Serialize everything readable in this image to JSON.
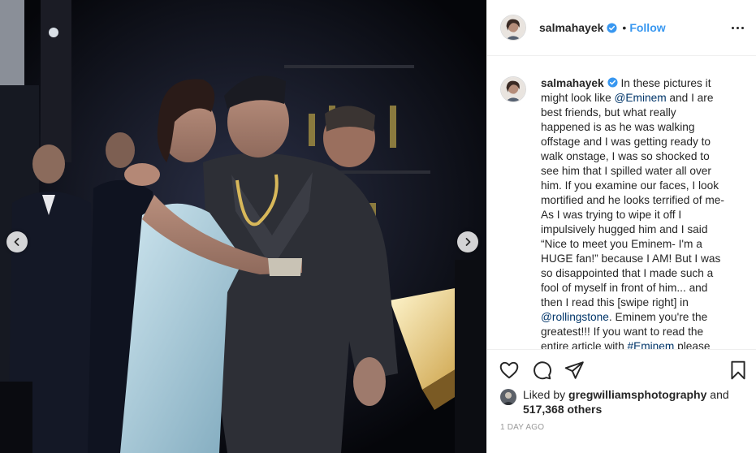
{
  "post": {
    "username": "salmahayek",
    "follow_label": "Follow",
    "dot": "•",
    "caption_lines": [
      "In these pictures it",
      "might look like ",
      " and I are",
      "best friends, but what really",
      "happened is as he was walking",
      "offstage and I was getting ready to",
      "walk onstage, I was so shocked to",
      "see him that I spilled water all over",
      "him. If you examine our faces, I look",
      "mortified and he looks terrified of me-",
      "As I was trying to wipe it off I",
      "impulsively hugged him and I said",
      "“Nice to meet you Eminem- I'm a",
      "HUGE fan!” because I AM! But I was",
      "so disappointed that I made such a",
      "fool of myself in front of him... and",
      "then I read this [swipe right] in",
      ". Eminem you're the",
      "greatest!!! If you want to read the",
      "entire article with ",
      " please"
    ],
    "mentions": {
      "eminem": "@Eminem",
      "rollingstone": "@rollingstone",
      "eminem_tag": "#Eminem"
    },
    "liked_by_prefix": "Liked by",
    "liked_by_user": "gregwilliamsphotography",
    "liked_by_and": "and",
    "likes_count": "517,368 others",
    "timestamp": "1 day ago"
  },
  "icons": {
    "like": "heart-icon",
    "comment": "comment-icon",
    "share": "share-icon",
    "save": "bookmark-icon",
    "more": "more-options-icon",
    "verified": "verified-badge-icon",
    "prev": "chevron-left-icon",
    "next": "chevron-right-icon"
  },
  "colors": {
    "accent": "#3897f0",
    "mention": "#003569",
    "text": "#262626",
    "muted": "#999999",
    "border": "#efefef"
  }
}
